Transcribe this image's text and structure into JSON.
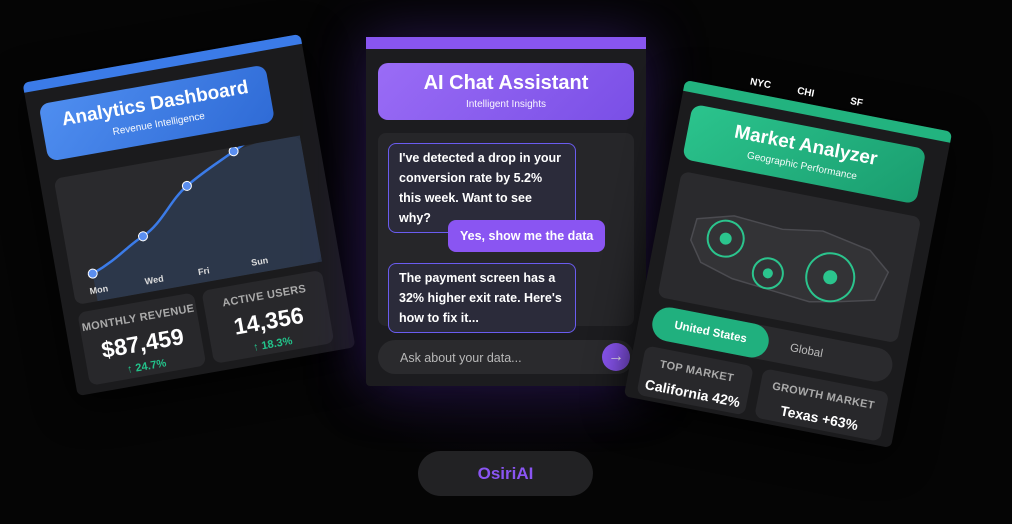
{
  "analytics": {
    "title": "Analytics Dashboard",
    "subtitle": "Revenue Intelligence",
    "days": [
      "Mon",
      "Wed",
      "Fri",
      "Sun"
    ],
    "accent": "#3b7be8",
    "stats": [
      {
        "label": "MONTHLY REVENUE",
        "value": "$87,459",
        "change": "↑ 24.7%"
      },
      {
        "label": "ACTIVE USERS",
        "value": "14,356",
        "change": "↑ 18.3%"
      }
    ]
  },
  "chat": {
    "title": "AI Chat Assistant",
    "subtitle": "Intelligent Insights",
    "accent": "#8a55f2",
    "messages": [
      {
        "role": "bot",
        "text": "I've detected a drop in your conversion rate by 5.2% this week. Want to see why?"
      },
      {
        "role": "user",
        "text": "Yes, show me the data"
      },
      {
        "role": "bot",
        "text": "The payment screen has a 32% higher exit rate. Here's how to fix it..."
      }
    ],
    "input_placeholder": "Ask about your data...",
    "send_icon": "arrow-right-icon",
    "send_glyph": "→"
  },
  "market": {
    "cities": [
      "NYC",
      "CHI",
      "SF"
    ],
    "title": "Market Analyzer",
    "subtitle": "Geographic Performance",
    "accent": "#22b37f",
    "toggle": {
      "active": "United States",
      "inactive": "Global"
    },
    "stats": [
      {
        "label": "TOP MARKET",
        "value": "California 42%"
      },
      {
        "label": "GROWTH MARKET",
        "value": "Texas +63%"
      }
    ]
  },
  "brand": {
    "name": "OsiriAI"
  }
}
